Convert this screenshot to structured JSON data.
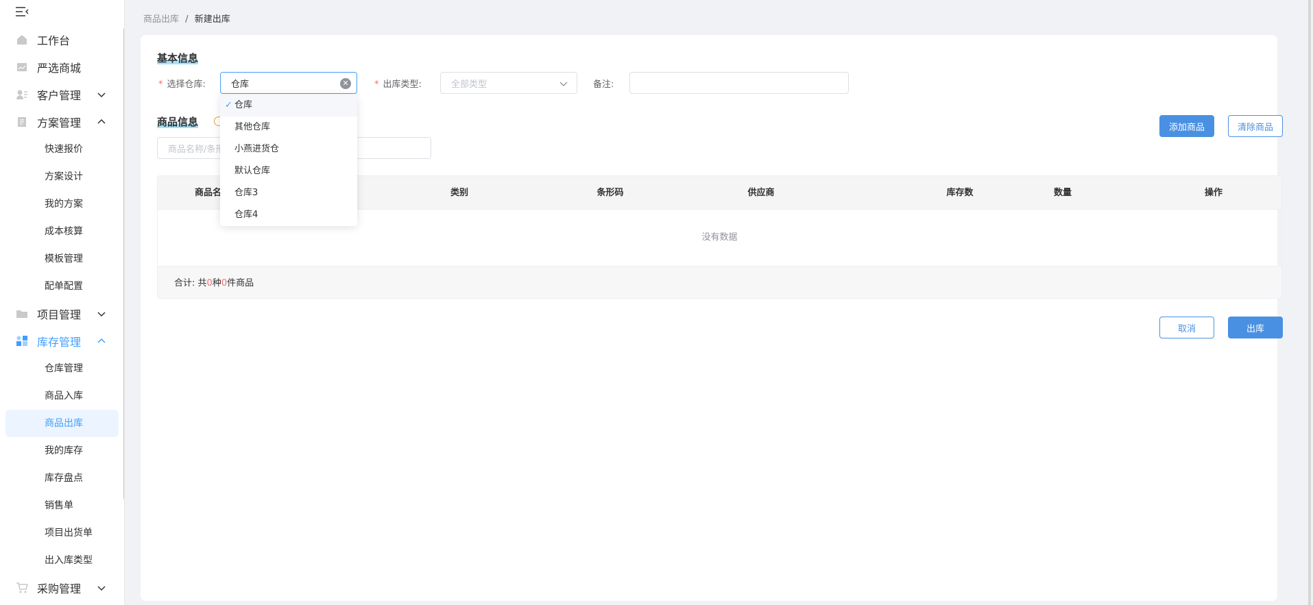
{
  "breadcrumb": {
    "parent": "商品出库",
    "separator": "/",
    "current": "新建出库"
  },
  "sidebar": {
    "menu": [
      {
        "label": "工作台",
        "icon": "home-icon"
      },
      {
        "label": "严选商城",
        "icon": "store-icon"
      },
      {
        "label": "客户管理",
        "icon": "customer-icon",
        "expanded": false
      },
      {
        "label": "方案管理",
        "icon": "document-icon",
        "expanded": true
      },
      {
        "label": "项目管理",
        "icon": "folder-icon",
        "expanded": false
      },
      {
        "label": "库存管理",
        "icon": "inventory-icon",
        "expanded": true,
        "active": true
      },
      {
        "label": "采购管理",
        "icon": "cart-icon",
        "expanded": false
      }
    ],
    "plan_sub": [
      "快速报价",
      "方案设计",
      "我的方案",
      "成本核算",
      "模板管理",
      "配单配置"
    ],
    "inventory_sub": [
      "仓库管理",
      "商品入库",
      "商品出库",
      "我的库存",
      "库存盘点",
      "销售单",
      "项目出货单",
      "出入库类型"
    ],
    "selected_sub": "商品出库"
  },
  "basic": {
    "title": "基本信息",
    "warehouse_label": "选择仓库:",
    "warehouse_value": "仓库",
    "type_label": "出库类型:",
    "type_placeholder": "全部类型",
    "remark_label": "备注:",
    "remark_value": ""
  },
  "goods": {
    "title": "商品信息",
    "search_placeholder": "商品名称/条形码",
    "add_button": "添加商品",
    "clear_button": "清除商品"
  },
  "table": {
    "columns": [
      "商品名称",
      "类别",
      "条形码",
      "供应商",
      "库存数",
      "数量",
      "操作"
    ],
    "empty_text": "没有数据",
    "footer": {
      "prefix": "合计: 共",
      "kinds": "0",
      "mid": "种",
      "count": "0",
      "suffix": "件商品"
    }
  },
  "actions": {
    "cancel": "取消",
    "submit": "出库"
  },
  "dropdown": {
    "options": [
      "仓库",
      "其他仓库",
      "小燕进货仓",
      "默认仓库",
      "仓库3",
      "仓库4"
    ],
    "selected": "仓库"
  },
  "colors": {
    "primary": "#4a90e2",
    "required": "#f56c6c",
    "active": "#409eff"
  }
}
